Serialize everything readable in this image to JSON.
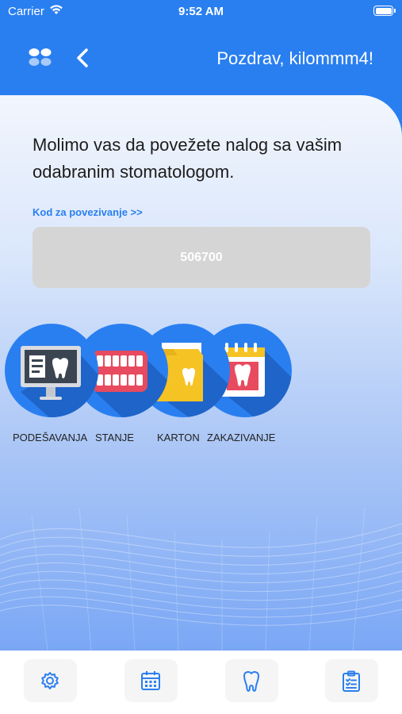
{
  "status": {
    "carrier": "Carrier",
    "time": "9:52 AM"
  },
  "header": {
    "greeting": "Pozdrav, kilommm4!",
    "icons": [
      "grid-menu-icon",
      "chevron-left-icon"
    ]
  },
  "main": {
    "instructions": "Molimo vas da povežete nalog sa vašim odabranim stomatologom.",
    "code_link": "Kod za povezivanje >>",
    "code": "506700",
    "menu": [
      {
        "label": "PODEŠAVANJA",
        "icon": "dental-xray-monitor-icon"
      },
      {
        "label": "STANJE",
        "icon": "teeth-icon"
      },
      {
        "label": "KARTON",
        "icon": "dental-folder-icon"
      },
      {
        "label": "ZAKAZIVANJE",
        "icon": "dental-calendar-icon"
      }
    ]
  },
  "tabbar": {
    "icons": [
      "gear-icon",
      "calendar-icon",
      "tooth-icon",
      "clipboard-checklist-icon"
    ]
  },
  "colors": {
    "primary": "#2a7ff0",
    "code_box": "#d5d5d5",
    "accent_red": "#e84a5f",
    "accent_yellow": "#f6c325"
  }
}
